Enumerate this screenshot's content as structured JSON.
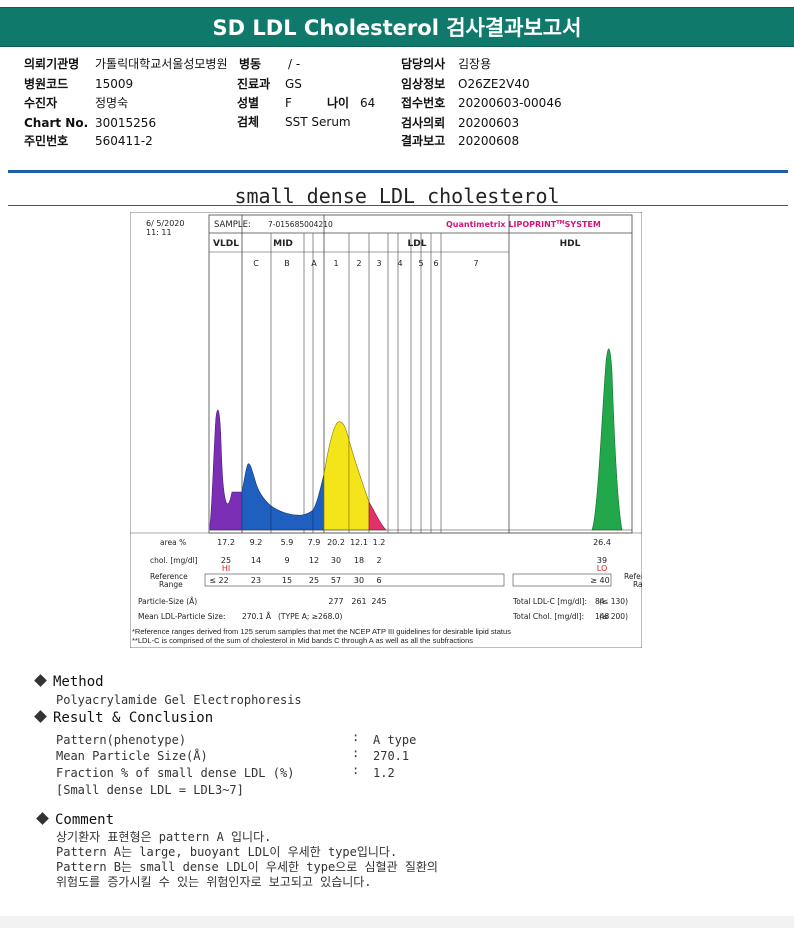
{
  "report": {
    "title": "SD LDL Cholesterol 검사결과보고서",
    "fields": {
      "institution_label": "의뢰기관명",
      "institution": "가톨릭대학교서울성모병원",
      "ward_label": "병동",
      "ward": "/ -",
      "doctor_label": "담당의사",
      "doctor": "김장용",
      "hospital_code_label": "병원코드",
      "hospital_code": "15009",
      "dept_label": "진료과",
      "dept": "GS",
      "clinical_info_label": "임상정보",
      "clinical_info": "O26ZE2V40",
      "patient_label": "수진자",
      "patient": "정명숙",
      "sex_label": "성별",
      "sex": "F",
      "age_label": "나이",
      "age": "64",
      "accession_label": "접수번호",
      "accession": "20200603-00046",
      "chart_no_label": "Chart No.",
      "chart_no": "30015256",
      "specimen_label": "검체",
      "specimen": "SST Serum",
      "request_date_label": "검사의뢰",
      "request_date": "20200603",
      "resident_no_label": "주민번호",
      "resident_no": "560411-2",
      "report_date_label": "결과보고",
      "report_date": "20200608"
    }
  },
  "chart_title": "small dense LDL cholesterol",
  "chart_data": {
    "type": "area",
    "date": "6/ 5/2020",
    "time": "11: 11",
    "sample_label": "SAMPLE:",
    "sample_id": "7-015685004210",
    "brand": "Quantimetrix LIPOPRINT",
    "brand_tm": "TM",
    "brand_suffix": "SYSTEM",
    "groups": [
      "VLDL",
      "MID",
      "LDL",
      "HDL"
    ],
    "bands": [
      "C",
      "B",
      "A",
      "1",
      "2",
      "3",
      "4",
      "5",
      "6",
      "7"
    ],
    "area_label": "area %",
    "area_values": [
      "17.2",
      "9.2",
      "5.9",
      "7.9",
      "20.2",
      "12.1",
      "1.2",
      "26.4"
    ],
    "chol_label": "chol. [mg/dl]",
    "chol_values": [
      "25",
      "14",
      "9",
      "12",
      "30",
      "18",
      "2",
      "39"
    ],
    "hi_flag": "HI",
    "lo_flag": "LO",
    "ref_label_1": "Reference",
    "ref_label_2": "Range",
    "ref_values": [
      "≤ 22",
      "23",
      "15",
      "25",
      "57",
      "30",
      "6"
    ],
    "hdl_ref": "≥ 40",
    "particle_label": "Particle-Size (Å)",
    "particle_values": [
      "277",
      "261",
      "245"
    ],
    "mean_ldl_label": "Mean LDL-Particle Size:",
    "mean_ldl_value": "270.1 Å",
    "mean_ldl_type": "(TYPE A; ≥268.0)",
    "total_ldl_label": "Total LDL-C [mg/dl]:",
    "total_ldl_value": "84",
    "total_ldl_ref": "(≤ 130)",
    "total_chol_label": "Total Chol. [mg/dl]:",
    "total_chol_value": "148",
    "total_chol_ref": "(≤ 200)",
    "footnote_1": "*Reference ranges derived from 125 serum samples that met the NCEP ATP III guidelines for desirable lipid status",
    "footnote_2": "**LDL-C is comprised of the sum of cholesterol in Mid bands C through A as well as all the subfractions"
  },
  "method": {
    "heading": "Method",
    "text": "Polyacrylamide Gel Electrophoresis"
  },
  "result": {
    "heading": "Result & Conclusion",
    "rows": [
      {
        "label": "Pattern(phenotype)",
        "sep": ":",
        "value": "A type"
      },
      {
        "label": "Mean Particle Size(Å)",
        "sep": ":",
        "value": "270.1"
      },
      {
        "label": "Fraction % of small dense LDL (%)",
        "sep": ":",
        "value": "1.2"
      }
    ],
    "note": "[Small dense LDL = LDL3~7]"
  },
  "comment": {
    "heading": "Comment",
    "lines": [
      "상기환자 표현형은 pattern A 입니다.",
      "Pattern A는 large, buoyant LDL이 우세한 type입니다.",
      "Pattern B는 small dense LDL이 우세한 type으로 심혈관 질환의",
      "위험도를 증가시킬 수 있는 위험인자로 보고되고 있습니다."
    ]
  }
}
